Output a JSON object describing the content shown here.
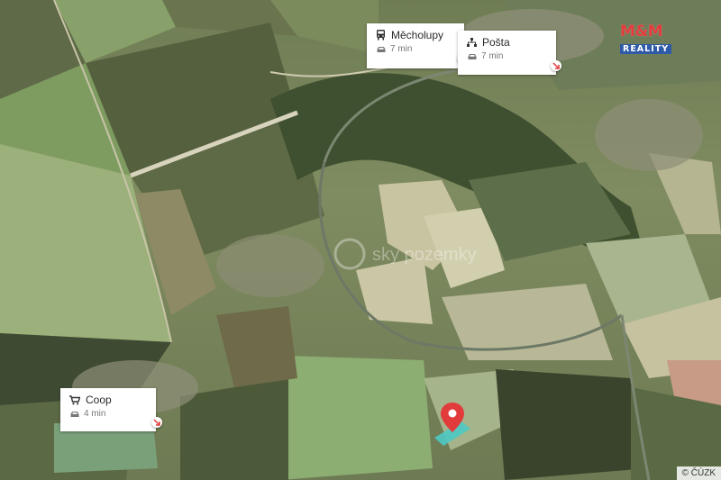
{
  "map": {
    "copyright": "© ČÚZK",
    "watermark_text": "sky pozemky",
    "brand": {
      "line1": "M&M",
      "line2": "REALITY",
      "colors": {
        "red": "#e23b3b",
        "blue": "#2f5aa8"
      }
    },
    "location_pin": {
      "icon": "map-pin-icon",
      "color": "#e23b3b"
    }
  },
  "pois": [
    {
      "name": "Měcholupy",
      "icon": "bus-icon",
      "travel_icon": "car-icon",
      "time": "7 min"
    },
    {
      "name": "Pošta",
      "icon": "post-office-icon",
      "travel_icon": "car-icon",
      "time": "7 min"
    },
    {
      "name": "Coop",
      "icon": "cart-icon",
      "travel_icon": "car-icon",
      "time": "4 min"
    }
  ]
}
